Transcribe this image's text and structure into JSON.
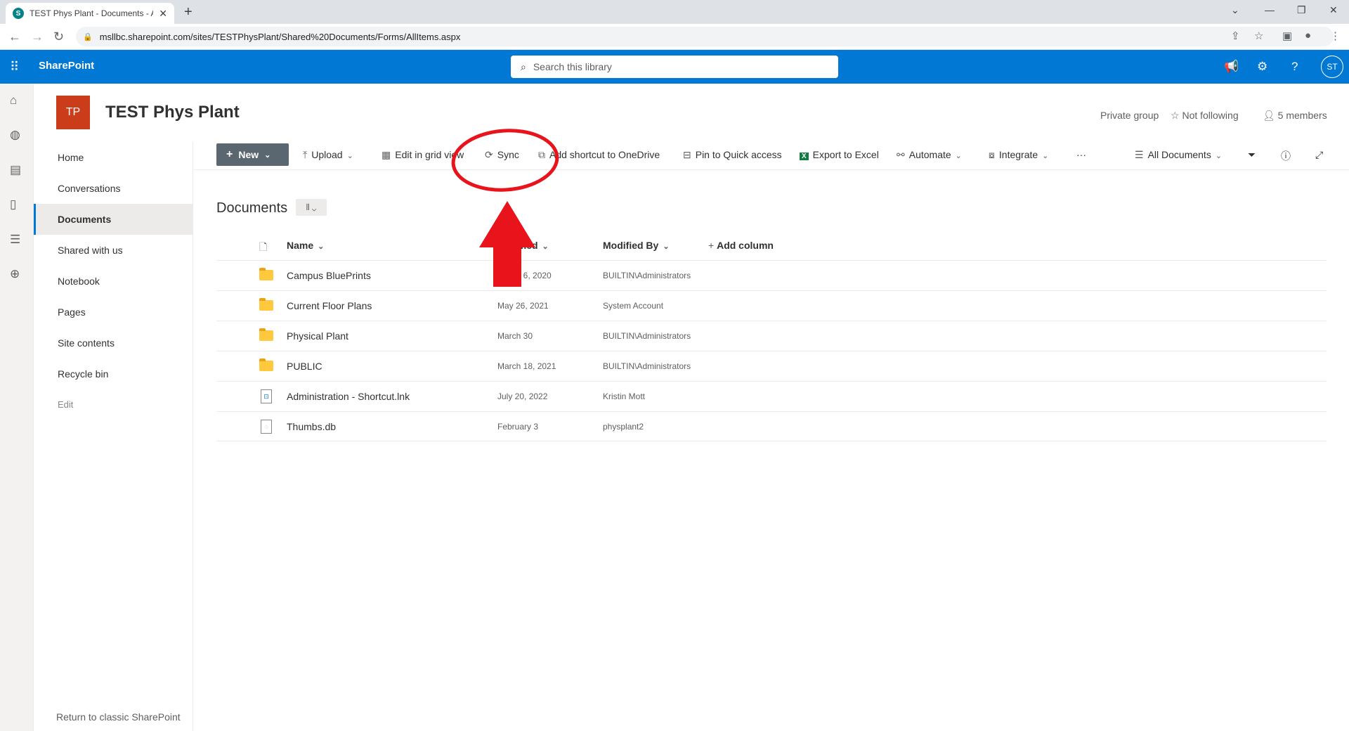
{
  "browser": {
    "tab_title": "TEST Phys Plant - Documents - A",
    "new_tab": "+",
    "url": "msllbc.sharepoint.com/sites/TESTPhysPlant/Shared%20Documents/Forms/AllItems.aspx"
  },
  "suite": {
    "brand": "SharePoint",
    "search_placeholder": "Search this library",
    "avatar_initials": "ST",
    "brand_color": "#0078d4"
  },
  "site": {
    "logo_initials": "TP",
    "logo_color": "#ca3c1a",
    "title": "TEST Phys Plant",
    "group_type": "Private group",
    "follow": "Not following",
    "members": "5 members"
  },
  "leftnav": {
    "items": [
      {
        "label": "Home"
      },
      {
        "label": "Conversations"
      },
      {
        "label": "Documents"
      },
      {
        "label": "Shared with us"
      },
      {
        "label": "Notebook"
      },
      {
        "label": "Pages"
      },
      {
        "label": "Site contents"
      },
      {
        "label": "Recycle bin"
      },
      {
        "label": "Edit"
      }
    ],
    "selected": "Documents",
    "classic_link": "Return to classic SharePoint"
  },
  "commandbar": {
    "new": "New",
    "upload": "Upload",
    "edit_grid": "Edit in grid view",
    "sync": "Sync",
    "add_shortcut": "Add shortcut to OneDrive",
    "pin": "Pin to Quick access",
    "export": "Export to Excel",
    "automate": "Automate",
    "integrate": "Integrate",
    "more": "···",
    "view": "All Documents"
  },
  "library": {
    "title": "Documents",
    "columns": {
      "name": "Name",
      "modified": "Modified",
      "modified_by": "Modified By",
      "add_column": "Add column"
    },
    "rows": [
      {
        "name": "Campus BluePrints",
        "modified": "March 6, 2020",
        "modified_by": "BUILTIN\\Administrators",
        "icon": "folder"
      },
      {
        "name": "Current Floor Plans",
        "modified": "May 26, 2021",
        "modified_by": "System Account",
        "icon": "folder"
      },
      {
        "name": "Physical Plant",
        "modified": "March 30",
        "modified_by": "BUILTIN\\Administrators",
        "icon": "folder"
      },
      {
        "name": "PUBLIC",
        "modified": "March 18, 2021",
        "modified_by": "BUILTIN\\Administrators",
        "icon": "folder"
      },
      {
        "name": "Administration - Shortcut.lnk",
        "modified": "July 20, 2022",
        "modified_by": "Kristin Mott",
        "icon": "link-file"
      },
      {
        "name": "Thumbs.db",
        "modified": "February 3",
        "modified_by": "physplant2",
        "icon": "generic-file"
      }
    ]
  },
  "annotation": {
    "color": "#e8131b",
    "target": "Sync"
  }
}
